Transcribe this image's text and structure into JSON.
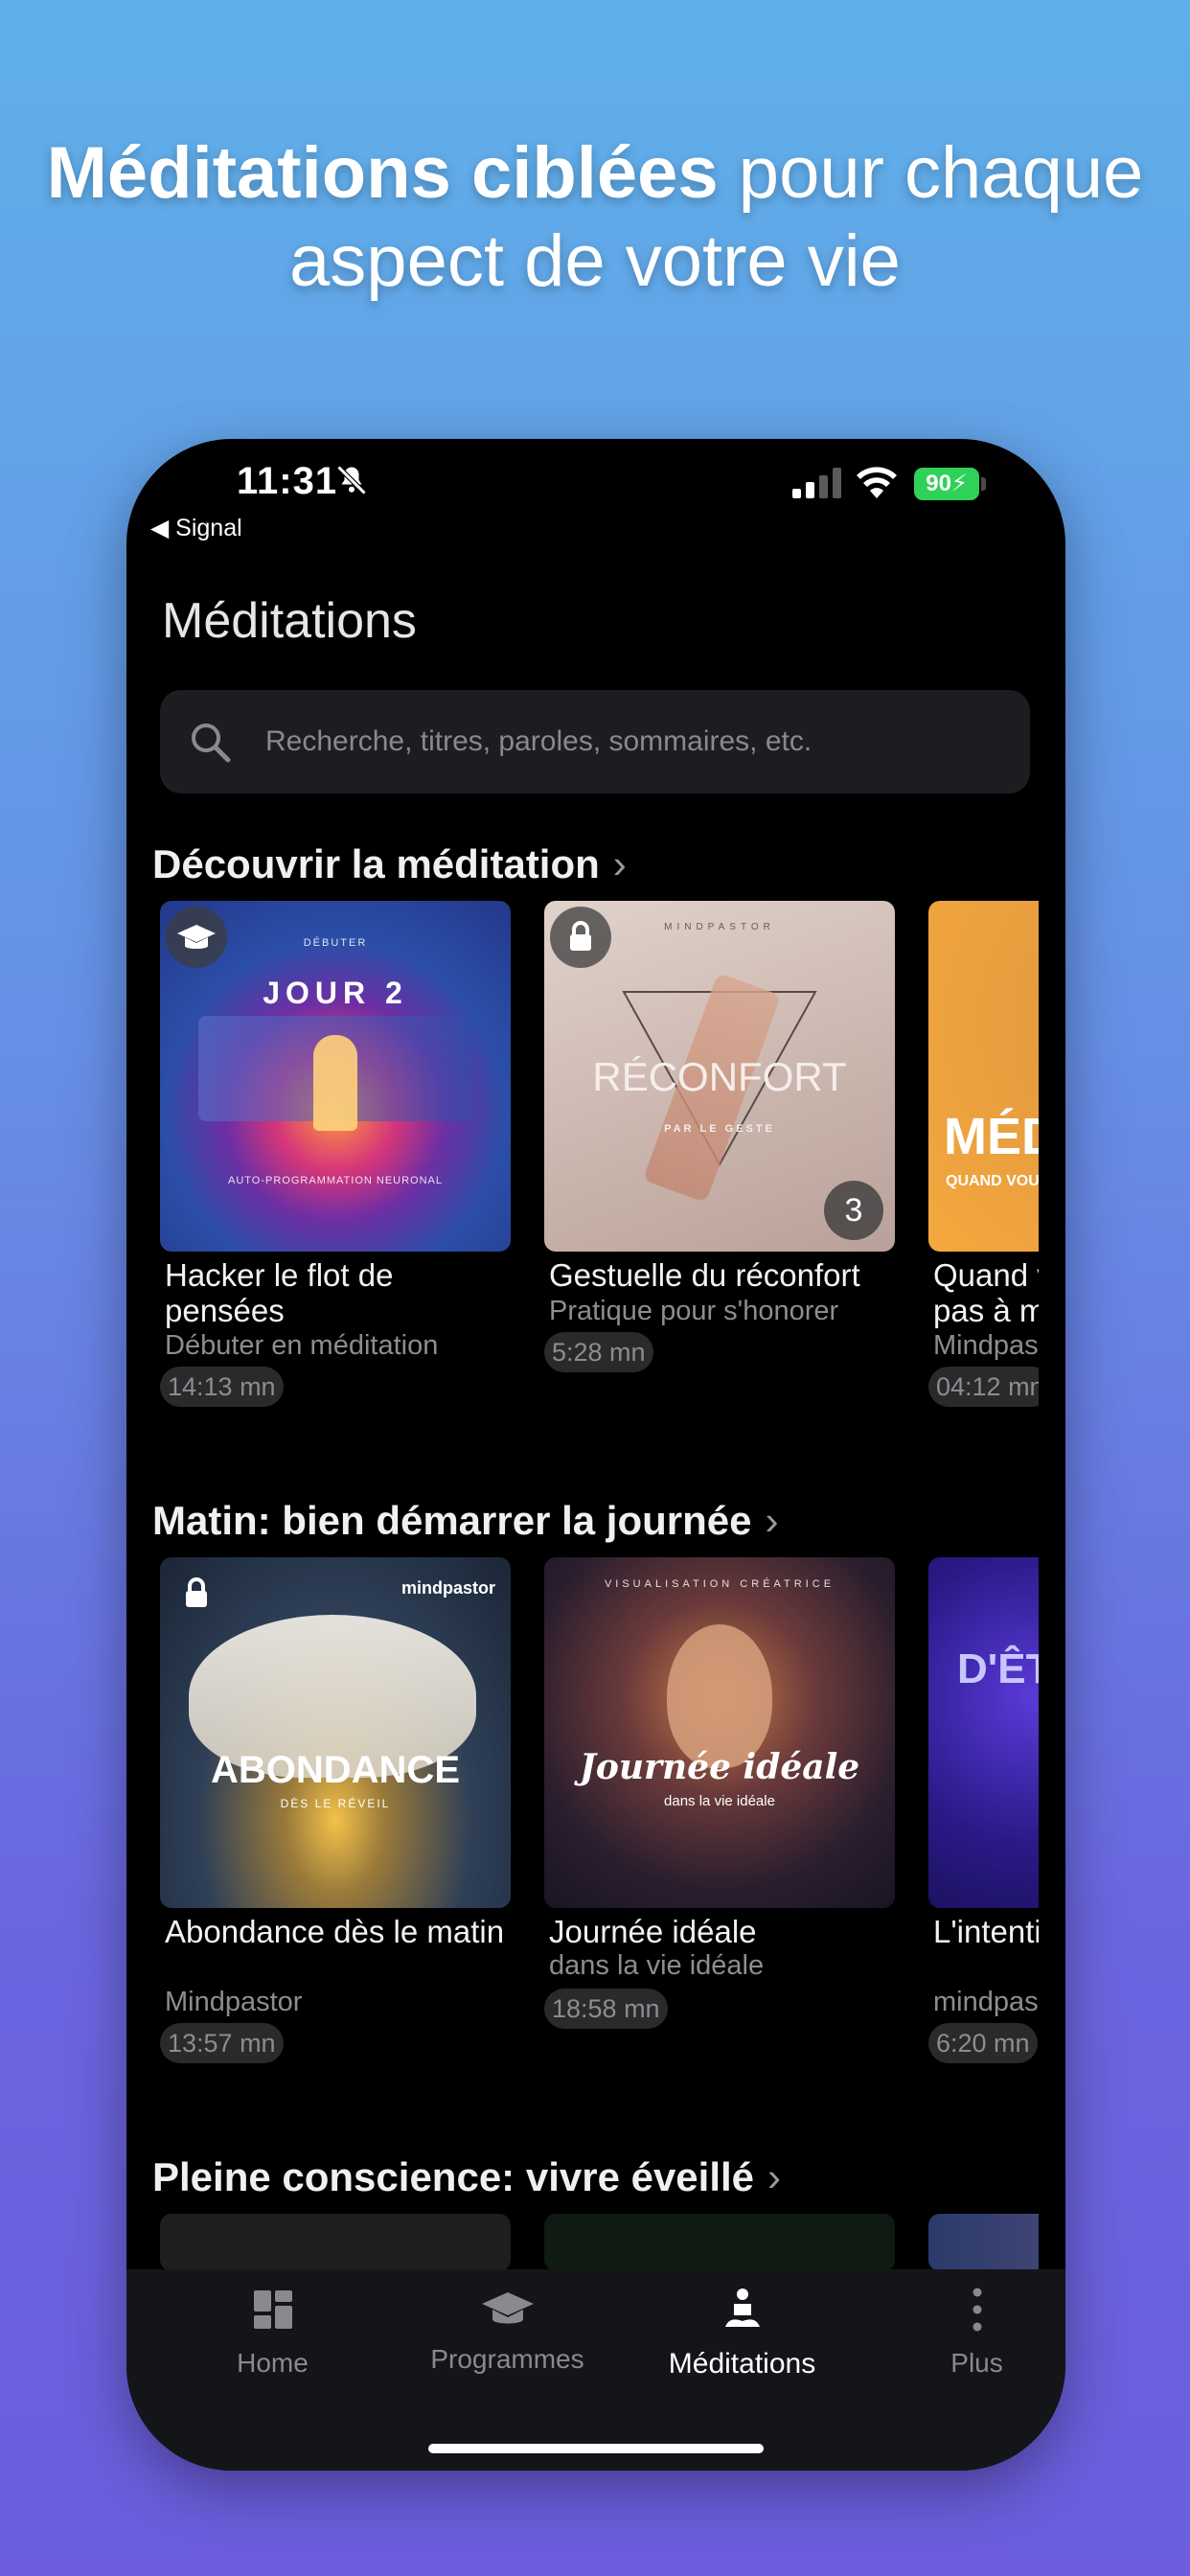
{
  "headline": {
    "bold": "Méditations ciblées",
    "rest": " pour chaque aspect de votre vie"
  },
  "status_bar": {
    "time": "11:31",
    "back_app": "◀ Signal",
    "battery": "90"
  },
  "page_title": "Méditations",
  "search": {
    "placeholder": "Recherche, titres, paroles, sommaires, etc."
  },
  "sections": [
    {
      "title": "Découvrir la méditation",
      "chevron": "›",
      "cards": [
        {
          "title": "Hacker le flot de pensées",
          "subtitle": "Débuter en méditation",
          "duration": "14:13 mn",
          "art_small": "DÉBUTER",
          "art_main": "JOUR 2",
          "art_footer": "AUTO-PROGRAMMATION NEURONAL",
          "badge": "graduation-cap"
        },
        {
          "title": "Gestuelle du réconfort",
          "subtitle": "Pratique pour s'honorer",
          "duration": "5:28 mn",
          "art_small": "MINDPASTOR",
          "art_main": "RÉCONFORT",
          "art_footer": "PAR LE GESTE",
          "badge": "lock",
          "count": "3"
        },
        {
          "title": "Quand vous n'arrivez pas à m",
          "subtitle": "Mindpastor",
          "duration": "04:12 mn",
          "art_main": "MÉDI",
          "art_footer": "QUAND VOUS N'ARRIVEZ"
        }
      ]
    },
    {
      "title": "Matin: bien démarrer la journée",
      "chevron": "›",
      "cards": [
        {
          "title": "Abondance dès le matin",
          "subtitle": "Mindpastor",
          "duration": "13:57 mn",
          "art_small": "mindpastor",
          "art_main": "ABONDANCE",
          "art_footer": "DÈS LE RÉVEIL",
          "badge": "lock"
        },
        {
          "title": "Journée idéale",
          "subtitle": "dans la vie idéale",
          "duration": "18:58 mn",
          "art_small": "VISUALISATION CRÉATRICE",
          "art_main": "Journée idéale",
          "art_footer": "dans la vie idéale"
        },
        {
          "title": "L'intention heureuse",
          "subtitle": "mindpastor",
          "duration": "6:20 mn",
          "art_main": "D'ÊTI"
        }
      ]
    },
    {
      "title": "Pleine conscience: vivre éveillé",
      "chevron": "›"
    }
  ],
  "tabs": [
    {
      "label": "Home",
      "icon": "grid-icon",
      "active": false
    },
    {
      "label": "Programmes",
      "icon": "graduation-cap-icon",
      "active": false
    },
    {
      "label": "Méditations",
      "icon": "meditation-icon",
      "active": true
    },
    {
      "label": "Plus",
      "icon": "more-vertical-icon",
      "active": false
    }
  ]
}
